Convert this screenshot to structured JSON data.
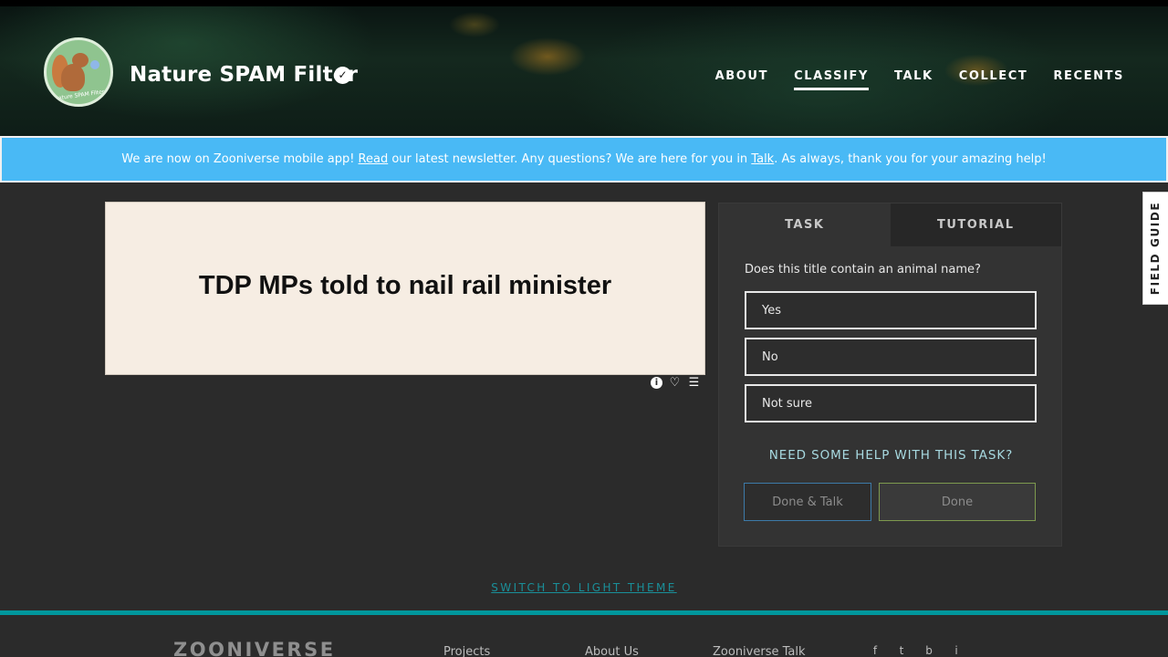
{
  "header": {
    "logo_text": "Nature SPAM Filter",
    "title": "Nature SPAM Filter",
    "verified_glyph": "✓",
    "nav": [
      {
        "label": "ABOUT"
      },
      {
        "label": "CLASSIFY"
      },
      {
        "label": "TALK"
      },
      {
        "label": "COLLECT"
      },
      {
        "label": "RECENTS"
      }
    ]
  },
  "banner": {
    "part1": "We are now on Zooniverse mobile app! ",
    "link1": "Read",
    "part2": " our latest newsletter. Any questions? We are here for you in ",
    "link2": "Talk",
    "part3": ". As always, thank you for your amazing help!"
  },
  "subject": {
    "text": "TDP MPs told to nail rail minister"
  },
  "subject_tools": {
    "info_glyph": "i",
    "favorite_glyph": "♡",
    "collect_glyph": "☰"
  },
  "task": {
    "tabs": [
      "TASK",
      "TUTORIAL"
    ],
    "question": "Does this title contain an animal name?",
    "answers": [
      "Yes",
      "No",
      "Not sure"
    ],
    "help": "NEED SOME HELP WITH THIS TASK?",
    "done_talk": "Done & Talk",
    "done": "Done"
  },
  "field_guide": "FIELD GUIDE",
  "theme_switch": "SWITCH TO LIGHT THEME",
  "footer": {
    "logo": "ZOONIVERSE",
    "links": [
      "Projects",
      "About Us",
      "Zooniverse Talk"
    ],
    "social": [
      "f",
      "t",
      "b",
      "i"
    ]
  },
  "colors": {
    "banner": "#49b9f5",
    "footer_accent": "#00979d",
    "help_link": "#a7d9e0"
  }
}
